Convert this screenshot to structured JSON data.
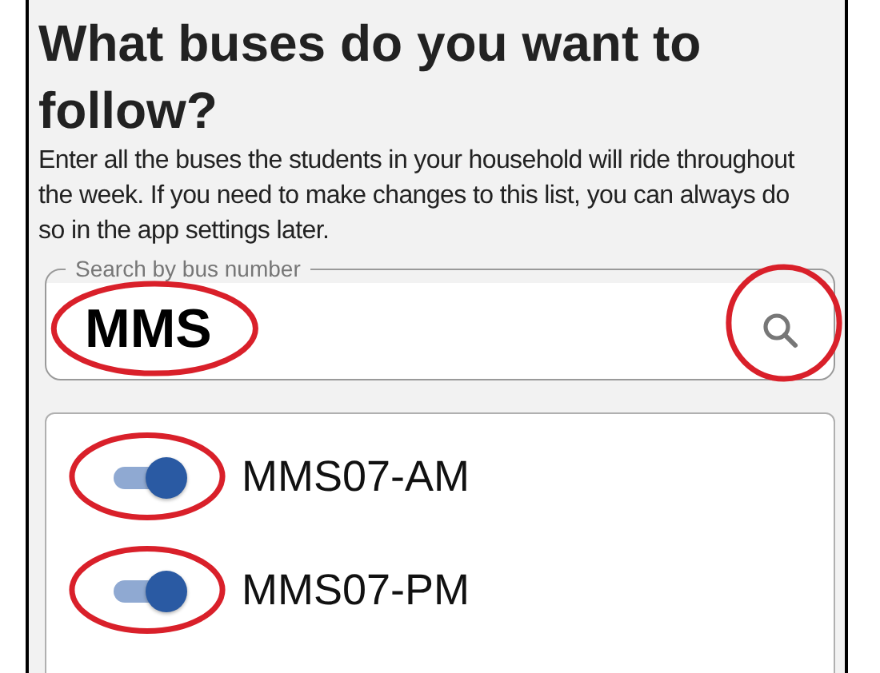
{
  "heading": "What buses do you want to follow?",
  "description": "Enter all the buses the students in your household will ride throughout the week. If you need to make changes to this list, you can always do so in the app settings later.",
  "search": {
    "label": "Search by bus number",
    "value": "MMS",
    "value_circled": true,
    "button_circled": true
  },
  "buses": [
    {
      "name": "MMS07-AM",
      "on": true,
      "circled": true
    },
    {
      "name": "MMS07-PM",
      "on": true,
      "circled": true
    }
  ]
}
